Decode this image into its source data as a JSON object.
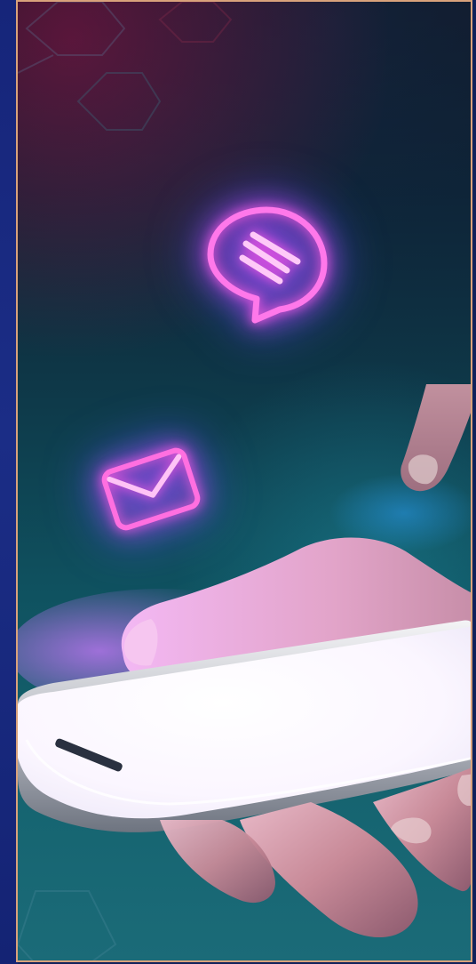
{
  "scene": {
    "description_tags": [
      "hand",
      "smartphone",
      "chat-bubble-icon",
      "envelope-icon"
    ],
    "colors": {
      "frame_border": "#d9a27b",
      "left_strip": "#16257a",
      "bg_top": "#101622",
      "bg_bottom": "#1b6b78",
      "neon_pink": "#ff5ee6",
      "neon_blue": "#5a56ff",
      "phone_screen": "#ffffff"
    }
  }
}
